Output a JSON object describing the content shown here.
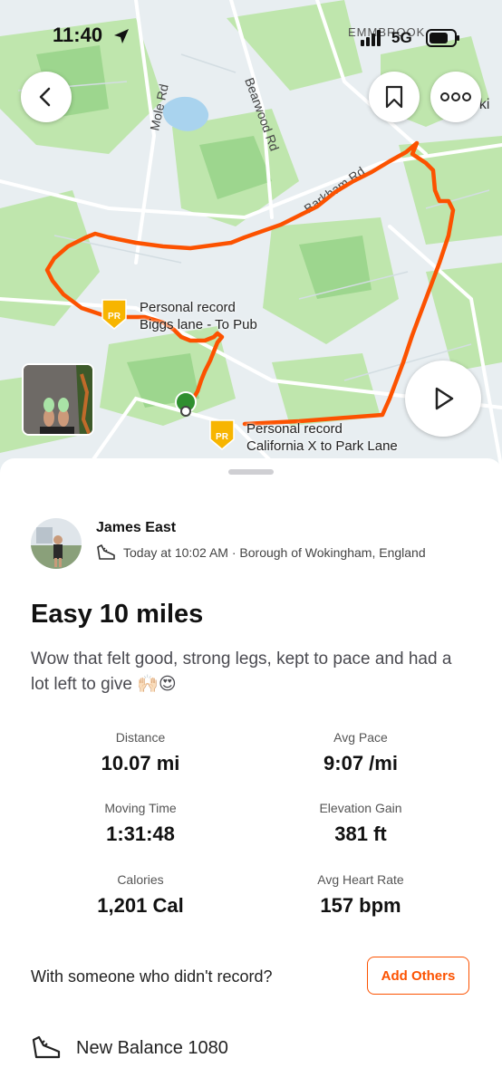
{
  "status_bar": {
    "time": "11:40",
    "network": "5G"
  },
  "map": {
    "place_labels": [
      "Mole Rd",
      "Bearwood Rd",
      "Barkham Rd",
      "EMMBROOK",
      "oki"
    ],
    "personal_records": [
      {
        "label": "Personal record",
        "segment": "Biggs lane - To Pub",
        "badge": "PR"
      },
      {
        "label": "Personal record",
        "segment": "California X to Park Lane",
        "badge": "PR"
      }
    ],
    "route_color": "#fc5200"
  },
  "activity": {
    "athlete": "James East",
    "time_text": "Today at 10:02 AM · Borough of Wokingham, England",
    "title": "Easy 10 miles",
    "description": "Wow that felt good, strong legs, kept to pace and had a lot left to give 🙌🏻😍",
    "stats": [
      {
        "label": "Distance",
        "value": "10.07 mi"
      },
      {
        "label": "Avg Pace",
        "value": "9:07 /mi"
      },
      {
        "label": "Moving Time",
        "value": "1:31:48"
      },
      {
        "label": "Elevation Gain",
        "value": "381 ft"
      },
      {
        "label": "Calories",
        "value": "1,201 Cal"
      },
      {
        "label": "Avg Heart Rate",
        "value": "157 bpm"
      }
    ],
    "with_prompt": "With someone who didn't record?",
    "add_button": "Add Others",
    "gear": "New Balance 1080"
  },
  "icons": [
    "back-icon",
    "bookmark-icon",
    "more-icon",
    "play-icon",
    "shoe-icon",
    "signal-icon",
    "battery-icon",
    "location-arrow-icon"
  ],
  "colors": {
    "accent": "#fc5200",
    "map_green": "#b9e3a6",
    "map_base": "#e9eef0"
  }
}
